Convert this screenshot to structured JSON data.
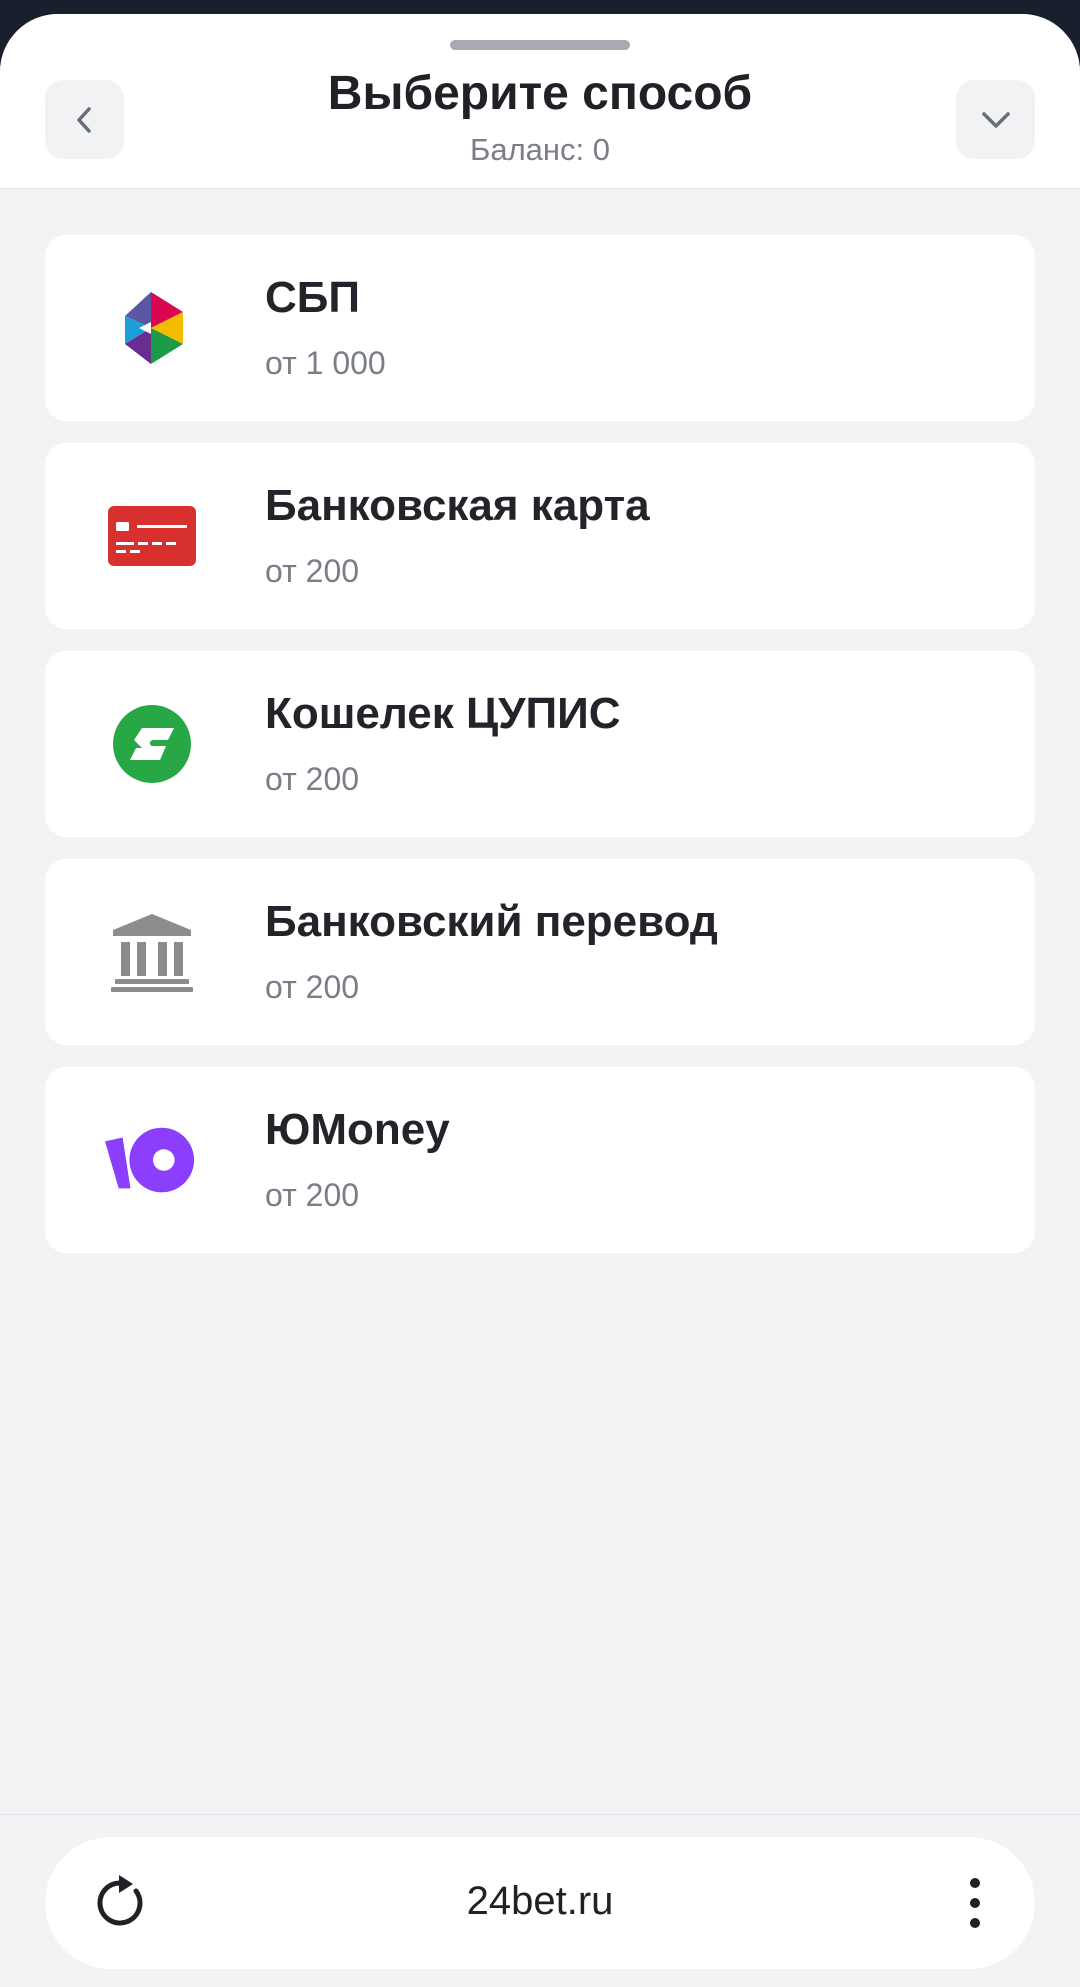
{
  "header": {
    "title": "Выберите способ",
    "subtitle": "Баланс: 0",
    "back_icon": "chevron-left-icon",
    "collapse_icon": "chevron-down-icon"
  },
  "methods": [
    {
      "name": "СБП",
      "min": "от 1 000",
      "icon": "sbp-logo-icon"
    },
    {
      "name": "Банковская карта",
      "min": "от 200",
      "icon": "bank-card-icon",
      "color": "#d8302f"
    },
    {
      "name": "Кошелек ЦУПИС",
      "min": "от 200",
      "icon": "cupis-wallet-icon",
      "color": "#27a745"
    },
    {
      "name": "Банковский перевод",
      "min": "от 200",
      "icon": "bank-building-icon",
      "color": "#8c8c8c"
    },
    {
      "name": "ЮMoney",
      "min": "от 200",
      "icon": "yumoney-logo-icon",
      "color": "#8b3ffd"
    }
  ],
  "browser": {
    "url": "24bet.ru",
    "reload_icon": "reload-icon",
    "menu_icon": "more-vertical-icon"
  }
}
